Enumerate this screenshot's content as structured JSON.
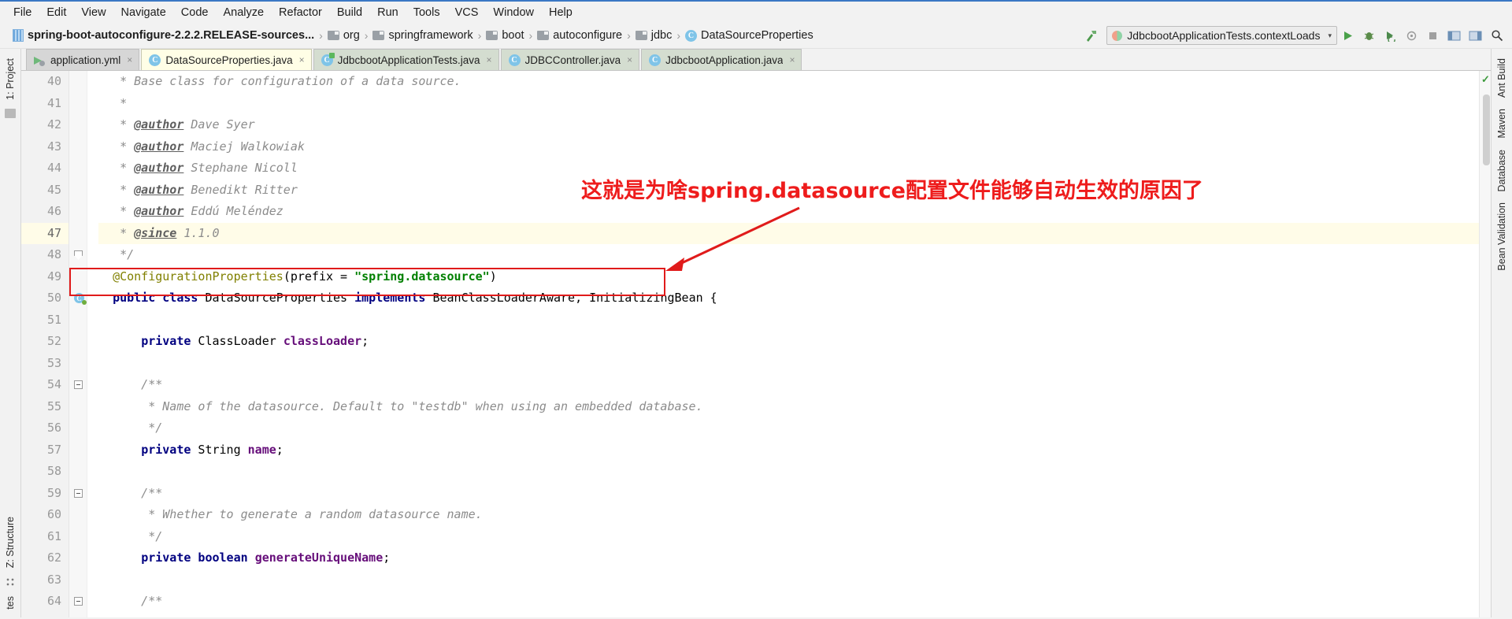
{
  "window": {
    "accent_color": "#3b78c4"
  },
  "menubar": {
    "items": [
      {
        "label": "File"
      },
      {
        "label": "Edit"
      },
      {
        "label": "View"
      },
      {
        "label": "Navigate"
      },
      {
        "label": "Code"
      },
      {
        "label": "Analyze"
      },
      {
        "label": "Refactor"
      },
      {
        "label": "Build"
      },
      {
        "label": "Run"
      },
      {
        "label": "Tools"
      },
      {
        "label": "VCS"
      },
      {
        "label": "Window"
      },
      {
        "label": "Help"
      }
    ]
  },
  "navbar": {
    "breadcrumb": [
      {
        "label": "spring-boot-autoconfigure-2.2.2.RELEASE-sources...",
        "icon": "module-icon"
      },
      {
        "label": "org",
        "icon": "folder-icon"
      },
      {
        "label": "springframework",
        "icon": "folder-icon"
      },
      {
        "label": "boot",
        "icon": "folder-icon"
      },
      {
        "label": "autoconfigure",
        "icon": "folder-icon"
      },
      {
        "label": "jdbc",
        "icon": "folder-icon"
      },
      {
        "label": "DataSourceProperties",
        "icon": "class-icon"
      }
    ],
    "separator": "›",
    "build_icon": "hammer-icon",
    "run_configuration": {
      "label": "JdbcbootApplicationTests.contextLoads",
      "icon": "run-config-icon",
      "caret": "▾"
    },
    "toolbar_buttons": [
      {
        "name": "run-button",
        "glyph": "▶",
        "color": "#4aa14a"
      },
      {
        "name": "debug-button",
        "glyph": "⚙",
        "color": "#4c7a3a"
      },
      {
        "name": "run-with-coverage-button",
        "glyph": "⟳",
        "color": "#4c7a3a"
      },
      {
        "name": "profile-button",
        "glyph": "◎",
        "color": "#8a8a8a"
      },
      {
        "name": "stop-button",
        "glyph": "■",
        "color": "#9a9a9a"
      },
      {
        "name": "layout-button-1",
        "glyph": "▤",
        "color": "#5b7fa6"
      },
      {
        "name": "layout-button-2",
        "glyph": "▥",
        "color": "#5b7fa6"
      },
      {
        "name": "search-everywhere-button",
        "glyph": "⚲",
        "color": "#3c3c3c"
      }
    ]
  },
  "left_strip": {
    "top_label": "1: Project",
    "bottom_labels": [
      "Z: Structure"
    ],
    "favorites_label": "tes"
  },
  "right_strip": {
    "labels": [
      "Ant Build",
      "Maven",
      "Database",
      "Bean Validation"
    ]
  },
  "tabs": [
    {
      "label": "application.yml",
      "icon": "yml-file-icon",
      "state": "inactive",
      "close": "×"
    },
    {
      "label": "DataSourceProperties.java",
      "icon": "java-class-icon",
      "state": "active",
      "close": "×"
    },
    {
      "label": "JdbcbootApplicationTests.java",
      "icon": "java-test-icon",
      "state": "test",
      "close": "×"
    },
    {
      "label": "JDBCController.java",
      "icon": "java-class-icon",
      "state": "inactive",
      "close": "×"
    },
    {
      "label": "JdbcbootApplication.java",
      "icon": "java-class-icon",
      "state": "inactive",
      "close": "×"
    }
  ],
  "editor": {
    "first_line_number": 40,
    "highlighted_line": 47,
    "caret_line": 49,
    "lines": [
      {
        "n": 40,
        "segments": [
          {
            "t": "   * Base class for configuration of a data source.",
            "c": "cmt"
          }
        ]
      },
      {
        "n": 41,
        "segments": [
          {
            "t": "   *",
            "c": "cmt"
          }
        ]
      },
      {
        "n": 42,
        "segments": [
          {
            "t": "   * ",
            "c": "cmt"
          },
          {
            "t": "@author",
            "c": "tag"
          },
          {
            "t": " Dave Syer",
            "c": "cmt"
          }
        ]
      },
      {
        "n": 43,
        "segments": [
          {
            "t": "   * ",
            "c": "cmt"
          },
          {
            "t": "@author",
            "c": "tag"
          },
          {
            "t": " Maciej Walkowiak",
            "c": "cmt"
          }
        ]
      },
      {
        "n": 44,
        "segments": [
          {
            "t": "   * ",
            "c": "cmt"
          },
          {
            "t": "@author",
            "c": "tag"
          },
          {
            "t": " Stephane Nicoll",
            "c": "cmt"
          }
        ]
      },
      {
        "n": 45,
        "segments": [
          {
            "t": "   * ",
            "c": "cmt"
          },
          {
            "t": "@author",
            "c": "tag"
          },
          {
            "t": " Benedikt Ritter",
            "c": "cmt"
          }
        ]
      },
      {
        "n": 46,
        "segments": [
          {
            "t": "   * ",
            "c": "cmt"
          },
          {
            "t": "@author",
            "c": "tag"
          },
          {
            "t": " Eddú Meléndez",
            "c": "cmt"
          }
        ]
      },
      {
        "n": 47,
        "segments": [
          {
            "t": "   * ",
            "c": "cmt"
          },
          {
            "t": "@since",
            "c": "tag"
          },
          {
            "t": " 1.1.0",
            "c": "cmt"
          }
        ],
        "hl": true
      },
      {
        "n": 48,
        "segments": [
          {
            "t": "   */",
            "c": "cmt"
          }
        ],
        "fold": "end"
      },
      {
        "n": 49,
        "segments": [
          {
            "t": "  ",
            "c": "plain"
          },
          {
            "t": "@ConfigurationProperties",
            "c": "anno"
          },
          {
            "t": "(prefix = ",
            "c": "plain"
          },
          {
            "t": "\"spring.datasource\"",
            "c": "str"
          },
          {
            "t": ")",
            "c": "plain"
          }
        ]
      },
      {
        "n": 50,
        "segments": [
          {
            "t": "  ",
            "c": "plain"
          },
          {
            "t": "public class",
            "c": "kw"
          },
          {
            "t": " DataSourceProperties ",
            "c": "plain"
          },
          {
            "t": "implements",
            "c": "kw"
          },
          {
            "t": " BeanClassLoaderAware, InitializingBean {",
            "c": "plain"
          }
        ],
        "gmark": "class"
      },
      {
        "n": 51,
        "segments": [
          {
            "t": "",
            "c": "plain"
          }
        ]
      },
      {
        "n": 52,
        "segments": [
          {
            "t": "      ",
            "c": "plain"
          },
          {
            "t": "private",
            "c": "kw"
          },
          {
            "t": " ClassLoader ",
            "c": "plain"
          },
          {
            "t": "classLoader",
            "c": "fld"
          },
          {
            "t": ";",
            "c": "plain"
          }
        ]
      },
      {
        "n": 53,
        "segments": [
          {
            "t": "",
            "c": "plain"
          }
        ]
      },
      {
        "n": 54,
        "segments": [
          {
            "t": "      /**",
            "c": "cmt"
          }
        ],
        "fold": "start"
      },
      {
        "n": 55,
        "segments": [
          {
            "t": "       * Name of the datasource. Default to \"testdb\" when using an embedded database.",
            "c": "cmt"
          }
        ]
      },
      {
        "n": 56,
        "segments": [
          {
            "t": "       */",
            "c": "cmt"
          }
        ]
      },
      {
        "n": 57,
        "segments": [
          {
            "t": "      ",
            "c": "plain"
          },
          {
            "t": "private",
            "c": "kw"
          },
          {
            "t": " String ",
            "c": "plain"
          },
          {
            "t": "name",
            "c": "fld"
          },
          {
            "t": ";",
            "c": "plain"
          }
        ]
      },
      {
        "n": 58,
        "segments": [
          {
            "t": "",
            "c": "plain"
          }
        ]
      },
      {
        "n": 59,
        "segments": [
          {
            "t": "      /**",
            "c": "cmt"
          }
        ],
        "fold": "start"
      },
      {
        "n": 60,
        "segments": [
          {
            "t": "       * Whether to generate a random datasource name.",
            "c": "cmt"
          }
        ]
      },
      {
        "n": 61,
        "segments": [
          {
            "t": "       */",
            "c": "cmt"
          }
        ]
      },
      {
        "n": 62,
        "segments": [
          {
            "t": "      ",
            "c": "plain"
          },
          {
            "t": "private",
            "c": "kw"
          },
          {
            "t": " boolean",
            "c": "kw"
          },
          {
            "t": " ",
            "c": "plain"
          },
          {
            "t": "generateUniqueName",
            "c": "fld"
          },
          {
            "t": ";",
            "c": "plain"
          }
        ]
      },
      {
        "n": 63,
        "segments": [
          {
            "t": "",
            "c": "plain"
          }
        ]
      },
      {
        "n": 64,
        "segments": [
          {
            "t": "      /**",
            "c": "cmt"
          }
        ],
        "fold": "start"
      }
    ],
    "inspection_status": "✓"
  },
  "annotation": {
    "text": "这就是为啥spring.datasource配置文件能够自动生效的原因了",
    "color": "#ee1c1c",
    "box_color": "#e01b1b"
  }
}
